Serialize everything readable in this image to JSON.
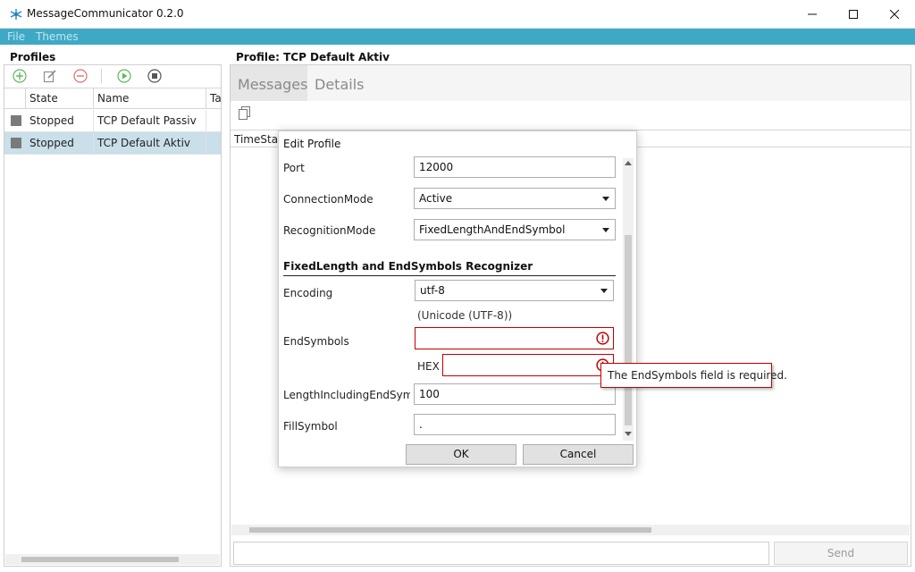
{
  "window": {
    "title": "MessageCommunicator 0.2.0"
  },
  "menu": {
    "items": [
      "File",
      "Themes"
    ]
  },
  "profiles": {
    "panel_title": "Profiles",
    "columns": [
      "State",
      "Name",
      "Ta"
    ],
    "rows": [
      {
        "state": "Stopped",
        "name": "TCP Default Passiv"
      },
      {
        "state": "Stopped",
        "name": "TCP Default Aktiv",
        "selected": true
      }
    ]
  },
  "profile_view": {
    "title": "Profile: TCP Default Aktiv",
    "tabs": [
      "Messages",
      "Details"
    ],
    "columns": [
      "TimeStan"
    ],
    "send_label": "Send"
  },
  "edit_dialog": {
    "title": "Edit Profile",
    "port_label": "Port",
    "port_value": "12000",
    "connection_mode_label": "ConnectionMode",
    "connection_mode_value": "Active",
    "recognition_mode_label": "RecognitionMode",
    "recognition_mode_value": "FixedLengthAndEndSymbol",
    "section_title": "FixedLength and EndSymbols Recognizer",
    "encoding_label": "Encoding",
    "encoding_value": "utf-8",
    "encoding_hint": "(Unicode (UTF-8))",
    "end_symbols_label": "EndSymbols",
    "end_symbols_value": "",
    "hex_label": "HEX",
    "hex_value": "",
    "length_label": "LengthIncludingEndSymbo",
    "length_value": "100",
    "fill_symbol_label": "FillSymbol",
    "fill_symbol_value": ".",
    "ok_label": "OK",
    "cancel_label": "Cancel",
    "validation_message": "The EndSymbols field is required."
  },
  "colors": {
    "accent": "#3fa9c5",
    "error": "#c00000",
    "selection": "#c9dfe9"
  }
}
